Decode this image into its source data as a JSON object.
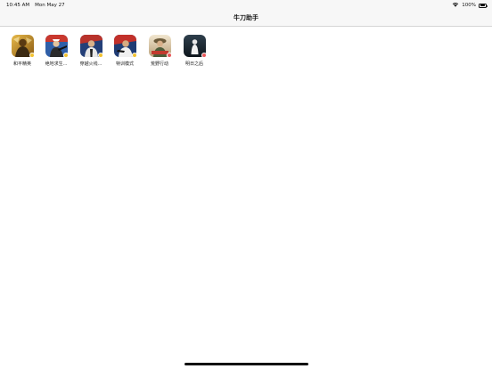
{
  "status_bar": {
    "time": "10:45 AM",
    "date": "Mon May 27",
    "battery_percent": "100%",
    "battery_level": 1.0
  },
  "nav": {
    "title": "牛刀助手"
  },
  "apps": [
    {
      "label": "和平精英",
      "badge": "yellow",
      "icon": "game-icon-heping"
    },
    {
      "label": "绝地求生...",
      "badge": "yellow",
      "icon": "game-icon-juedi"
    },
    {
      "label": "穿越火线...",
      "badge": "yellow",
      "icon": "game-icon-chuanyue"
    },
    {
      "label": "特训模式",
      "badge": "yellow",
      "icon": "game-icon-texun"
    },
    {
      "label": "荒野行动",
      "badge": "red",
      "icon": "game-icon-huangye"
    },
    {
      "label": "明日之后",
      "badge": "red",
      "icon": "game-icon-mingri"
    }
  ],
  "colors": {
    "badge_yellow": "#f2c230",
    "badge_red": "#e8585a",
    "bar_background": "#f7f7f7"
  }
}
